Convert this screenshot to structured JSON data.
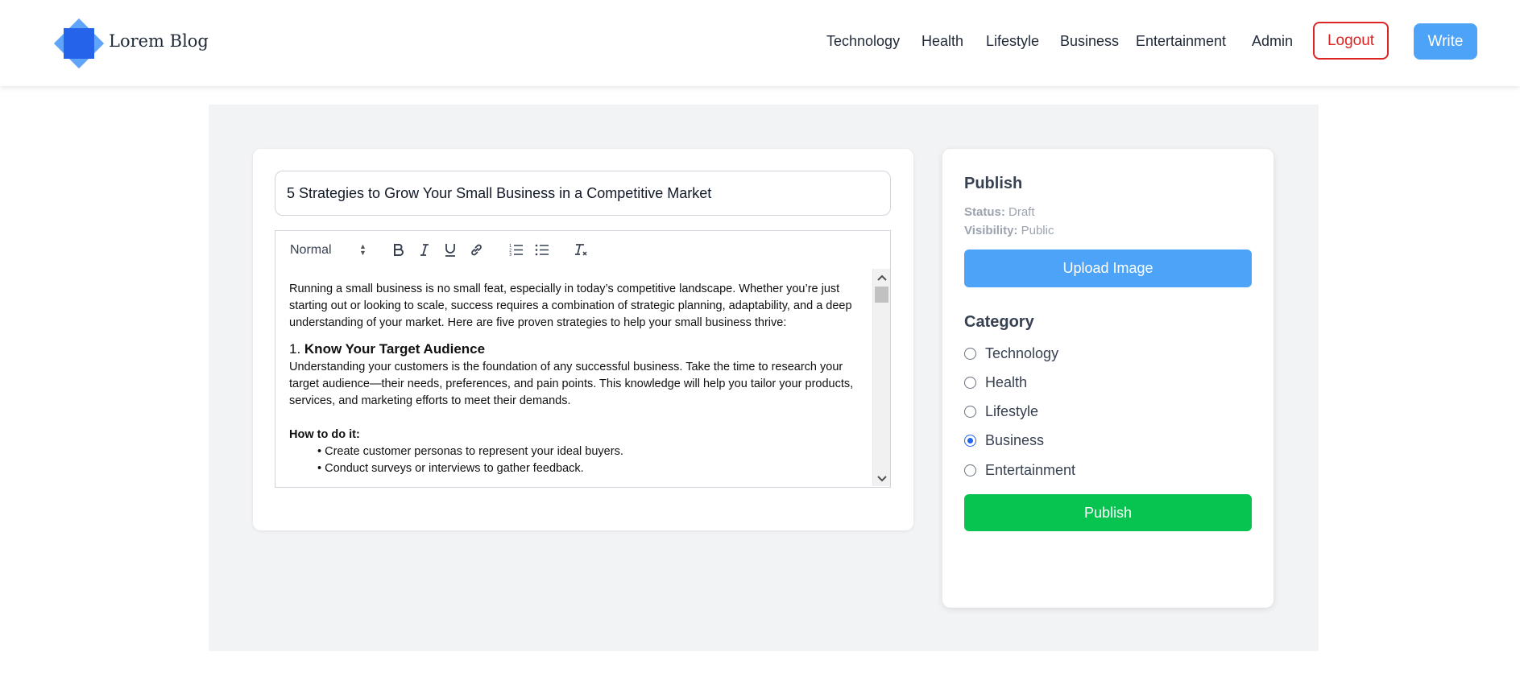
{
  "header": {
    "brand": "Lorem Blog",
    "nav": [
      "Technology",
      "Health",
      "Lifestyle",
      "Business",
      "Entertainment",
      "Admin"
    ],
    "logout_label": "Logout",
    "write_label": "Write"
  },
  "editor": {
    "title_value": "5 Strategies to Grow Your Small Business in a Competitive Market",
    "toolbar": {
      "format_select": "Normal",
      "buttons": [
        "bold-icon",
        "italic-icon",
        "underline-icon",
        "link-icon",
        "ordered-list-icon",
        "bullet-list-icon",
        "clear-format-icon"
      ]
    },
    "content": {
      "intro": "Running a small business is no small feat, especially in today’s competitive landscape. Whether you’re just starting out or looking to scale, success requires a combination of strategic planning, adaptability, and a deep understanding of your market. Here are five proven strategies to help your small business thrive:",
      "heading_num": "1. ",
      "heading_text": "Know Your Target Audience",
      "paragraph": "Understanding your customers is the foundation of any successful business. Take the time to research your target audience—their needs, preferences, and pain points. This knowledge will help you tailor your products, services, and marketing efforts to meet their demands.",
      "how_label": "How to do it:",
      "bullets": [
        "• Create customer personas to represent your ideal buyers.",
        "• Conduct surveys or interviews to gather feedback."
      ]
    }
  },
  "publish": {
    "title": "Publish",
    "status_label": "Status:",
    "status_value": "Draft",
    "visibility_label": "Visibility:",
    "visibility_value": "Public",
    "upload_label": "Upload Image",
    "category_title": "Category",
    "categories": [
      "Technology",
      "Health",
      "Lifestyle",
      "Business",
      "Entertainment"
    ],
    "selected_category": "Business",
    "publish_label": "Publish"
  },
  "colors": {
    "primary_blue": "#4da3f7",
    "logout_red": "#dc2626",
    "publish_green": "#06c44f",
    "radio_blue": "#2563eb"
  }
}
